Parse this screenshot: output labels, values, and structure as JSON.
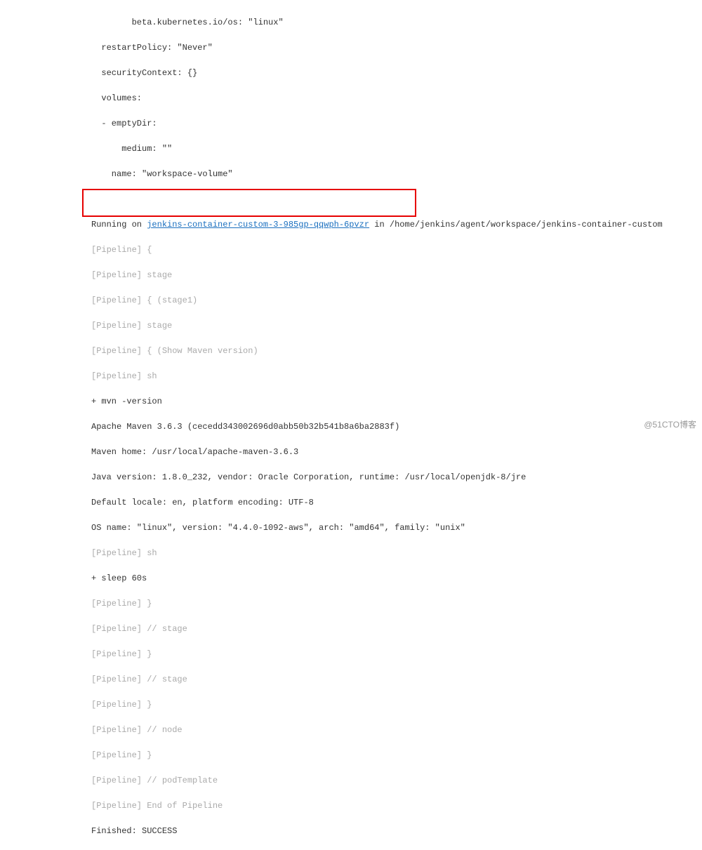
{
  "config": {
    "l1": "        beta.kubernetes.io/os: \"linux\"",
    "l2": "  restartPolicy: \"Never\"",
    "l3": "  securityContext: {}",
    "l4": "  volumes:",
    "l5": "  - emptyDir:",
    "l6": "      medium: \"\"",
    "l7": "    name: \"workspace-volume\""
  },
  "running": {
    "prefix": "Running on ",
    "link": "jenkins-container-custom-3-985gp-qqwph-6pvzr",
    "suffix": " in /home/jenkins/agent/workspace/jenkins-container-custom"
  },
  "pipe": {
    "p1": "[Pipeline] {",
    "p2": "[Pipeline] stage",
    "p3": "[Pipeline] { (stage1)",
    "p4": "[Pipeline] stage",
    "p5": "[Pipeline] { (Show Maven version)",
    "p6": "[Pipeline] sh"
  },
  "cmd": {
    "c1": "+ mvn -version",
    "c2": "Apache Maven 3.6.3 (cecedd343002696d0abb50b32b541b8a6ba2883f)",
    "c3": "Maven home: /usr/local/apache-maven-3.6.3",
    "c4": "Java version: 1.8.0_232, vendor: Oracle Corporation, runtime: /usr/local/openjdk-8/jre",
    "c5": "Default locale: en, platform encoding: UTF-8",
    "c6": "OS name: \"linux\", version: \"4.4.0-1092-aws\", arch: \"amd64\", family: \"unix\""
  },
  "pipe2": {
    "p7": "[Pipeline] sh"
  },
  "cmd2": {
    "c7": "+ sleep 60s"
  },
  "pipe3": {
    "p8": "[Pipeline] }",
    "p9": "[Pipeline] // stage",
    "p10": "[Pipeline] }",
    "p11": "[Pipeline] // stage",
    "p12": "[Pipeline] }",
    "p13": "[Pipeline] // node",
    "p14": "[Pipeline] }",
    "p15": "[Pipeline] // podTemplate",
    "p16": "[Pipeline] End of Pipeline"
  },
  "finish": "Finished: SUCCESS",
  "watermark": "@51CTO博客"
}
